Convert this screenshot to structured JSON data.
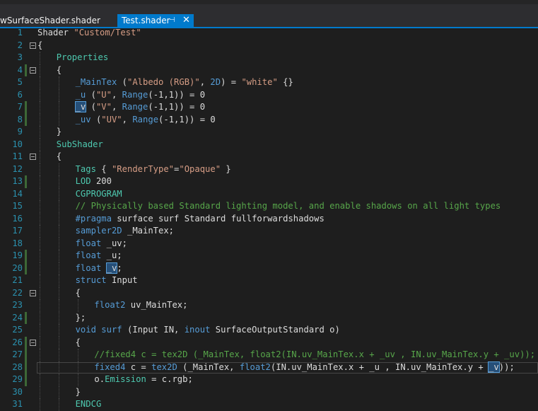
{
  "tabs": [
    {
      "label": "wSurfaceShader.shader",
      "active": false
    },
    {
      "label": "Test.shader",
      "active": true,
      "pin": "⊣",
      "close": "✕"
    }
  ],
  "lines": [
    {
      "n": "1",
      "fold": false,
      "bar": false,
      "indent": 0,
      "segs": [
        [
          "ident",
          "Shader "
        ],
        [
          "s",
          "\"Custom/Test\""
        ]
      ]
    },
    {
      "n": "2",
      "fold": true,
      "bar": false,
      "indent": 0,
      "segs": [
        [
          "ident",
          "{"
        ]
      ]
    },
    {
      "n": "3",
      "fold": false,
      "bar": false,
      "indent": 1,
      "segs": [
        [
          "t",
          "Properties"
        ]
      ]
    },
    {
      "n": "4",
      "fold": true,
      "bar": true,
      "indent": 1,
      "segs": [
        [
          "ident",
          "{"
        ]
      ]
    },
    {
      "n": "5",
      "fold": false,
      "bar": false,
      "indent": 2,
      "segs": [
        [
          "prop",
          "_MainTex"
        ],
        [
          "ident",
          " ("
        ],
        [
          "s",
          "\"Albedo (RGB)\""
        ],
        [
          "ident",
          ", "
        ],
        [
          "k",
          "2D"
        ],
        [
          "ident",
          ") = "
        ],
        [
          "s",
          "\"white\""
        ],
        [
          "ident",
          " {}"
        ]
      ]
    },
    {
      "n": "6",
      "fold": false,
      "bar": false,
      "indent": 2,
      "segs": [
        [
          "prop",
          "_u"
        ],
        [
          "ident",
          " ("
        ],
        [
          "s",
          "\"U\""
        ],
        [
          "ident",
          ", "
        ],
        [
          "k",
          "Range"
        ],
        [
          "ident",
          "(-1,1)) = 0"
        ]
      ]
    },
    {
      "n": "7",
      "fold": false,
      "bar": true,
      "indent": 2,
      "segs": [
        [
          "sel",
          "_v"
        ],
        [
          "ident",
          " ("
        ],
        [
          "s",
          "\"V\""
        ],
        [
          "ident",
          ", "
        ],
        [
          "k",
          "Range"
        ],
        [
          "ident",
          "(-1,1)) = 0"
        ]
      ]
    },
    {
      "n": "8",
      "fold": false,
      "bar": true,
      "indent": 2,
      "segs": [
        [
          "prop",
          "_uv"
        ],
        [
          "ident",
          " ("
        ],
        [
          "s",
          "\"UV\""
        ],
        [
          "ident",
          ", "
        ],
        [
          "k",
          "Range"
        ],
        [
          "ident",
          "(-1,1)) = 0"
        ]
      ]
    },
    {
      "n": "9",
      "fold": false,
      "bar": false,
      "indent": 1,
      "segs": [
        [
          "ident",
          "}"
        ]
      ]
    },
    {
      "n": "10",
      "fold": false,
      "bar": false,
      "indent": 1,
      "segs": [
        [
          "t",
          "SubShader"
        ]
      ]
    },
    {
      "n": "11",
      "fold": true,
      "bar": false,
      "indent": 1,
      "segs": [
        [
          "ident",
          "{"
        ]
      ]
    },
    {
      "n": "12",
      "fold": false,
      "bar": false,
      "indent": 2,
      "segs": [
        [
          "t",
          "Tags"
        ],
        [
          "ident",
          " { "
        ],
        [
          "s",
          "\"RenderType\""
        ],
        [
          "ident",
          "="
        ],
        [
          "s",
          "\"Opaque\""
        ],
        [
          "ident",
          " }"
        ]
      ]
    },
    {
      "n": "13",
      "fold": false,
      "bar": true,
      "indent": 2,
      "segs": [
        [
          "t",
          "LOD"
        ],
        [
          "ident",
          " 200"
        ]
      ]
    },
    {
      "n": "14",
      "fold": false,
      "bar": false,
      "indent": 2,
      "segs": [
        [
          "t",
          "CGPROGRAM"
        ]
      ]
    },
    {
      "n": "15",
      "fold": false,
      "bar": false,
      "indent": 2,
      "segs": [
        [
          "c",
          "// Physically based Standard lighting model, and enable shadows on all light types"
        ]
      ]
    },
    {
      "n": "16",
      "fold": false,
      "bar": false,
      "indent": 2,
      "segs": [
        [
          "k",
          "#pragma"
        ],
        [
          "ident",
          " surface surf Standard fullforwardshadows"
        ]
      ]
    },
    {
      "n": "17",
      "fold": false,
      "bar": false,
      "indent": 2,
      "segs": [
        [
          "k",
          "sampler2D"
        ],
        [
          "ident",
          " _MainTex;"
        ]
      ]
    },
    {
      "n": "18",
      "fold": false,
      "bar": false,
      "indent": 2,
      "segs": [
        [
          "k",
          "float"
        ],
        [
          "ident",
          " _uv;"
        ]
      ]
    },
    {
      "n": "19",
      "fold": false,
      "bar": true,
      "indent": 2,
      "segs": [
        [
          "k",
          "float"
        ],
        [
          "ident",
          " _u;"
        ]
      ]
    },
    {
      "n": "20",
      "fold": false,
      "bar": true,
      "indent": 2,
      "segs": [
        [
          "k",
          "float"
        ],
        [
          "ident",
          " "
        ],
        [
          "sel",
          "_v"
        ],
        [
          "ident",
          ";"
        ]
      ]
    },
    {
      "n": "21",
      "fold": false,
      "bar": false,
      "indent": 2,
      "segs": [
        [
          "k",
          "struct"
        ],
        [
          "ident",
          " Input"
        ]
      ]
    },
    {
      "n": "22",
      "fold": true,
      "bar": false,
      "indent": 2,
      "segs": [
        [
          "ident",
          "{"
        ]
      ]
    },
    {
      "n": "23",
      "fold": false,
      "bar": false,
      "indent": 3,
      "segs": [
        [
          "k",
          "float2"
        ],
        [
          "ident",
          " uv_MainTex;"
        ]
      ]
    },
    {
      "n": "24",
      "fold": false,
      "bar": true,
      "indent": 2,
      "segs": [
        [
          "ident",
          "};"
        ]
      ]
    },
    {
      "n": "25",
      "fold": false,
      "bar": false,
      "indent": 2,
      "segs": [
        [
          "k",
          "void"
        ],
        [
          "ident",
          " "
        ],
        [
          "k",
          "surf"
        ],
        [
          "ident",
          " (Input IN, "
        ],
        [
          "k",
          "inout"
        ],
        [
          "ident",
          " SurfaceOutputStandard o)"
        ]
      ]
    },
    {
      "n": "26",
      "fold": true,
      "bar": true,
      "indent": 2,
      "segs": [
        [
          "ident",
          "{"
        ]
      ]
    },
    {
      "n": "27",
      "fold": false,
      "bar": true,
      "indent": 3,
      "segs": [
        [
          "c",
          "//fixed4 c = tex2D (_MainTex, float2(IN.uv_MainTex.x + _uv , IN.uv_MainTex.y + _uv));"
        ]
      ]
    },
    {
      "n": "28",
      "fold": false,
      "bar": true,
      "indent": 3,
      "current": true,
      "segs": [
        [
          "k",
          "fixed4"
        ],
        [
          "ident",
          " c = "
        ],
        [
          "k",
          "tex2D"
        ],
        [
          "ident",
          " (_MainTex, "
        ],
        [
          "k",
          "float2"
        ],
        [
          "ident",
          "(IN.uv_MainTex.x + _u , IN.uv_MainTex.y + "
        ],
        [
          "sel",
          "_v"
        ],
        [
          "ident",
          "));"
        ]
      ]
    },
    {
      "n": "29",
      "fold": false,
      "bar": true,
      "indent": 3,
      "segs": [
        [
          "ident",
          "o."
        ],
        [
          "t",
          "Emission"
        ],
        [
          "ident",
          " = c.rgb;"
        ]
      ]
    },
    {
      "n": "30",
      "fold": false,
      "bar": false,
      "indent": 2,
      "segs": [
        [
          "ident",
          "}"
        ]
      ]
    },
    {
      "n": "31",
      "fold": false,
      "bar": false,
      "indent": 2,
      "segs": [
        [
          "t",
          "ENDCG"
        ]
      ]
    }
  ]
}
